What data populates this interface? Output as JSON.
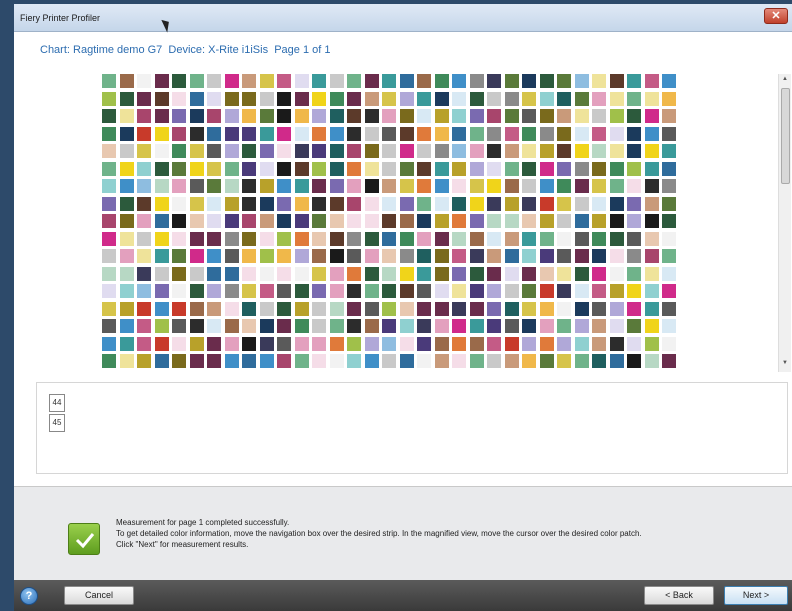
{
  "window": {
    "title": "Fiery Printer Profiler",
    "close_glyph": "✕"
  },
  "header": {
    "chart_label": "Chart:",
    "chart_name": "Ragtime demo G7",
    "device_label": "Device:",
    "device_name": "X-Rite i1iSis",
    "page_label": "Page 1 of 1"
  },
  "strips": {
    "rows": [
      {
        "label": "44"
      },
      {
        "label": "45"
      }
    ]
  },
  "status": {
    "icon": "checkmark-icon",
    "lines": [
      "Measurement for page 1 completed successfully.",
      "To get detailed color information, move the navigation box over the desired strip. In the magnified view, move the cursor over the desired color patch.",
      "Click \"Next\" for measurement results."
    ]
  },
  "buttons": {
    "help": "?",
    "cancel": "Cancel",
    "back": "< Back",
    "next": "Next >"
  },
  "palette": [
    "#5a5a5a",
    "#2c2c2c",
    "#8a8a8a",
    "#c9c9c9",
    "#f2f2f2",
    "#1b3a5c",
    "#2f6c9c",
    "#3f8fc8",
    "#8ebde0",
    "#d8e9f4",
    "#6a2c4c",
    "#a8456c",
    "#c45b86",
    "#e3a0be",
    "#f5dde8",
    "#7a6a1c",
    "#b8a12a",
    "#d6c44a",
    "#efe39a",
    "#2c5a3c",
    "#3f8a5a",
    "#6fb38a",
    "#b7d8c4",
    "#5c3a2a",
    "#9a6a4a",
    "#c99a7a",
    "#e8c8b0",
    "#1f5f5f",
    "#3a9a9a",
    "#8fd0d0",
    "#4a3a7a",
    "#7a6ab0",
    "#b0a8d8",
    "#e0dcf0",
    "#c83a2a",
    "#e07a3a",
    "#f0b84a",
    "#d02a8a",
    "#f0d41a",
    "#1a1a1a",
    "#3a3a5a",
    "#5a7a3a",
    "#a0c04a"
  ]
}
